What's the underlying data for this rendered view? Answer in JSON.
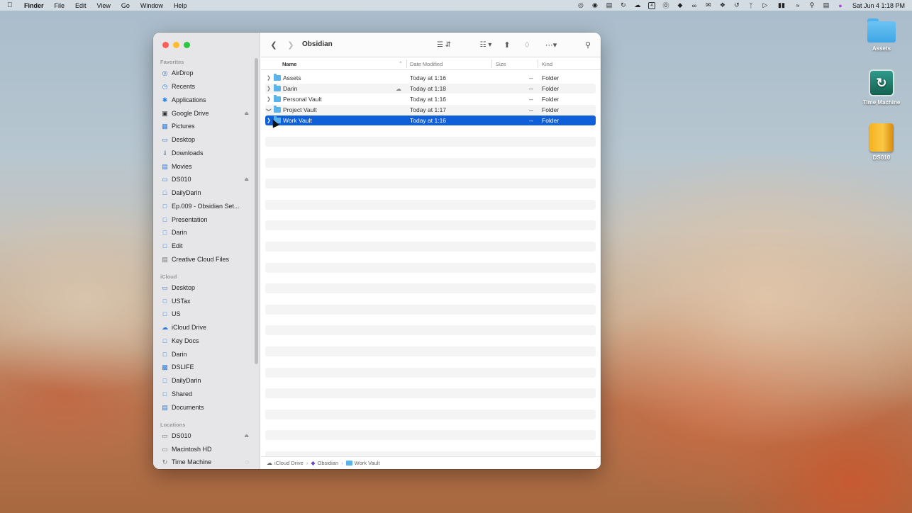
{
  "menubar": {
    "app": "Finder",
    "items": [
      "File",
      "Edit",
      "View",
      "Go",
      "Window",
      "Help"
    ],
    "status_icons": [
      "creative-cloud-icon",
      "sync-icon",
      "text-icon",
      "history-icon",
      "cloud-icon",
      "calendar-icon",
      "onepassword-icon",
      "tag-icon",
      "glasses-icon",
      "message-icon",
      "dropbox-icon",
      "backup-icon",
      "bluetooth-icon",
      "play-icon",
      "battery-icon",
      "wifi-icon",
      "search-icon",
      "control-center-icon",
      "siri-icon"
    ],
    "calendar_day": "4",
    "clock": "Sat Jun 4  1:18 PM"
  },
  "desktop": {
    "icons": [
      {
        "label": "Assets",
        "icon": "folder-icon"
      },
      {
        "label": "Time Machine",
        "icon": "time-machine-icon"
      },
      {
        "label": "DS010",
        "icon": "external-disk-icon"
      }
    ]
  },
  "sidebar": {
    "favorites_header": "Favorites",
    "favorites": [
      {
        "label": "AirDrop",
        "icon": "airdrop-icon"
      },
      {
        "label": "Recents",
        "icon": "clock-icon"
      },
      {
        "label": "Applications",
        "icon": "applications-icon"
      },
      {
        "label": "Google Drive",
        "icon": "drive-icon",
        "eject": true
      },
      {
        "label": "Pictures",
        "icon": "pictures-icon"
      },
      {
        "label": "Desktop",
        "icon": "desktop-icon"
      },
      {
        "label": "Downloads",
        "icon": "downloads-icon"
      },
      {
        "label": "Movies",
        "icon": "movies-icon"
      },
      {
        "label": "DS010",
        "icon": "disk-icon",
        "eject": true
      },
      {
        "label": "DailyDarin",
        "icon": "folder-icon"
      },
      {
        "label": "Ep.009 - Obsidian Set...",
        "icon": "folder-icon"
      },
      {
        "label": "Presentation",
        "icon": "folder-icon"
      },
      {
        "label": "Darin",
        "icon": "folder-icon"
      },
      {
        "label": "Edit",
        "icon": "folder-icon"
      },
      {
        "label": "Creative Cloud Files",
        "icon": "document-icon"
      }
    ],
    "icloud_header": "iCloud",
    "icloud": [
      {
        "label": "Desktop",
        "icon": "desktop-icon"
      },
      {
        "label": "USTax",
        "icon": "folder-icon"
      },
      {
        "label": "US",
        "icon": "folder-icon"
      },
      {
        "label": "iCloud Drive",
        "icon": "icloud-icon"
      },
      {
        "label": "Key Docs",
        "icon": "folder-icon"
      },
      {
        "label": "Darin",
        "icon": "folder-icon"
      },
      {
        "label": "DSLIFE",
        "icon": "server-icon"
      },
      {
        "label": "DailyDarin",
        "icon": "folder-icon"
      },
      {
        "label": "Shared",
        "icon": "shared-folder-icon"
      },
      {
        "label": "Documents",
        "icon": "document-icon"
      }
    ],
    "locations_header": "Locations",
    "locations": [
      {
        "label": "DS010",
        "icon": "disk-icon",
        "eject": true
      },
      {
        "label": "Macintosh HD",
        "icon": "disk-icon"
      },
      {
        "label": "Time Machine",
        "icon": "time-machine-icon",
        "spinner": true
      }
    ]
  },
  "toolbar": {
    "title": "Obsidian"
  },
  "columns": {
    "name": "Name",
    "date": "Date Modified",
    "size": "Size",
    "kind": "Kind"
  },
  "files": [
    {
      "name": "Assets",
      "date": "Today at 1:16",
      "size": "--",
      "kind": "Folder",
      "expanded": false,
      "selected": false,
      "cloud": false
    },
    {
      "name": "Darin",
      "date": "Today at 1:18",
      "size": "--",
      "kind": "Folder",
      "expanded": false,
      "selected": false,
      "cloud": true
    },
    {
      "name": "Personal Vault",
      "date": "Today at 1:16",
      "size": "--",
      "kind": "Folder",
      "expanded": false,
      "selected": false,
      "cloud": false
    },
    {
      "name": "Project Vault",
      "date": "Today at 1:17",
      "size": "--",
      "kind": "Folder",
      "expanded": true,
      "selected": false,
      "cloud": false
    },
    {
      "name": "Work Vault",
      "date": "Today at 1:16",
      "size": "--",
      "kind": "Folder",
      "expanded": false,
      "selected": true,
      "cloud": false
    }
  ],
  "pathbar": {
    "segments": [
      {
        "label": "iCloud Drive",
        "icon": "icloud-icon"
      },
      {
        "label": "Obsidian",
        "icon": "obsidian-icon"
      },
      {
        "label": "Work Vault",
        "icon": "folder-icon"
      }
    ]
  }
}
